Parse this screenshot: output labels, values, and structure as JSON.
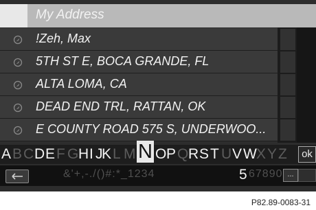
{
  "header": {
    "placeholder": "My Address"
  },
  "list": {
    "items": [
      {
        "label": "!Zeh, Max",
        "icon": "compass-icon"
      },
      {
        "label": "5TH ST E, BOCA GRANDE, FL",
        "icon": "compass-icon"
      },
      {
        "label": "ALTA LOMA, CA",
        "icon": "compass-icon"
      },
      {
        "label": "DEAD END TRL, RATTAN, OK",
        "icon": "compass-icon"
      },
      {
        "label": "E COUNTY ROAD 575 S, UNDERWOO...",
        "icon": "compass-icon"
      }
    ]
  },
  "keyboard": {
    "letters": [
      {
        "ch": "A",
        "active": true
      },
      {
        "ch": "B",
        "active": false
      },
      {
        "ch": "C",
        "active": false
      },
      {
        "ch": "D",
        "active": true
      },
      {
        "ch": "E",
        "active": true
      },
      {
        "ch": "F",
        "active": false
      },
      {
        "ch": "G",
        "active": false
      },
      {
        "ch": "H",
        "active": true
      },
      {
        "ch": "I",
        "active": true
      },
      {
        "ch": "J",
        "active": true
      },
      {
        "ch": "K",
        "active": true
      },
      {
        "ch": "L",
        "active": false
      },
      {
        "ch": "M",
        "active": false
      },
      {
        "ch": "N",
        "active": true,
        "selected": true
      },
      {
        "ch": "O",
        "active": true
      },
      {
        "ch": "P",
        "active": true
      },
      {
        "ch": "Q",
        "active": false
      },
      {
        "ch": "R",
        "active": true
      },
      {
        "ch": "S",
        "active": true
      },
      {
        "ch": "T",
        "active": true
      },
      {
        "ch": "U",
        "active": false
      },
      {
        "ch": "V",
        "active": true
      },
      {
        "ch": "W",
        "active": true
      },
      {
        "ch": "X",
        "active": false
      },
      {
        "ch": "Y",
        "active": false
      },
      {
        "ch": "Z",
        "active": false
      }
    ],
    "ok_label": "ok",
    "symbols_dim": "&'+,-./()#:*_1234",
    "digit_active": "5",
    "symbols_dim_after": "67890",
    "more_label": "...",
    "colors": {
      "active_key": "#f3f3f3",
      "inactive_key": "#5c5c5c",
      "selected_bg": "#e9e9e9"
    }
  },
  "footer": {
    "reference": "P82.89-0083-31"
  }
}
